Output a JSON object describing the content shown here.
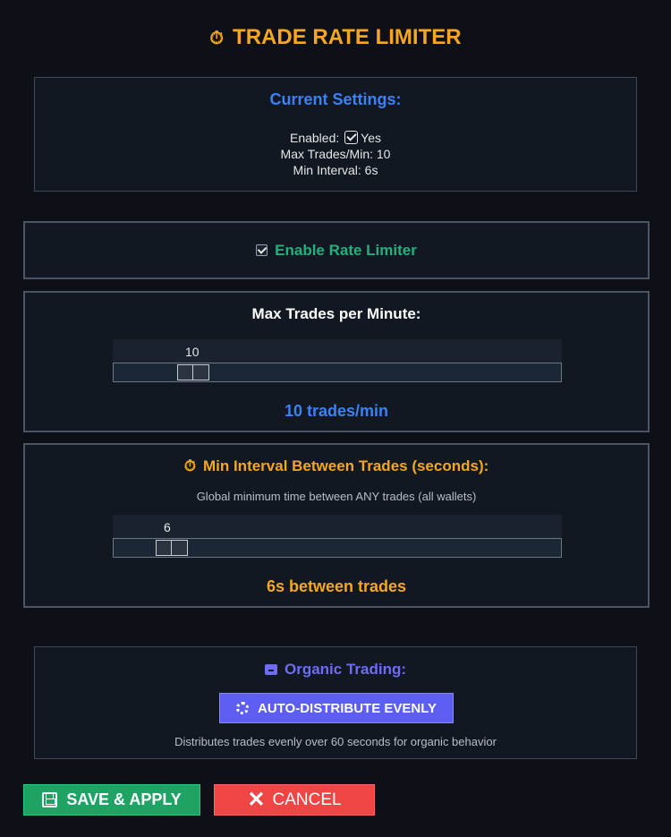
{
  "header": {
    "icon": "stopwatch-icon",
    "title": "TRADE RATE LIMITER"
  },
  "current_settings": {
    "title": "Current Settings:",
    "enabled_label": "Enabled:",
    "enabled_value": "Yes",
    "max_trades_line": "Max Trades/Min: 10",
    "min_interval_line": "Min Interval: 6s"
  },
  "enable_toggle": {
    "label": "Enable Rate Limiter",
    "checked": true
  },
  "max_trades": {
    "title": "Max Trades per Minute:",
    "value": "10",
    "slider_fraction": 0.153,
    "readout": "10 trades/min"
  },
  "min_interval": {
    "icon": "stopwatch-icon",
    "title": "Min Interval Between Trades (seconds):",
    "description": "Global minimum time between ANY trades (all wallets)",
    "value": "6",
    "slider_fraction": 0.1,
    "readout": "6s between trades"
  },
  "organic": {
    "icon": "package-icon",
    "title": "Organic Trading:",
    "button_label": "AUTO-DISTRIBUTE EVENLY",
    "description": "Distributes trades evenly over 60 seconds for organic behavior"
  },
  "actions": {
    "save_label": "SAVE & APPLY",
    "cancel_label": "CANCEL"
  },
  "colors": {
    "accent_orange": "#f5a623",
    "accent_blue": "#3b82f6",
    "accent_green": "#22b07d",
    "accent_purple": "#6d6cf2",
    "save_green": "#1fa364",
    "cancel_red": "#f04545"
  }
}
